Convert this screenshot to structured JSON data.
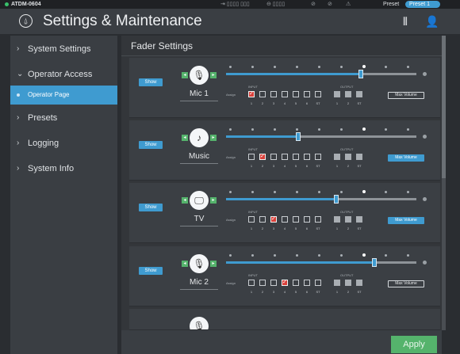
{
  "topbar": {
    "device": "ATDM-0604",
    "indicators": [
      "⇥ ▯▯▯▯ ▯▯▯",
      "⊖ ▯▯▯▯",
      "⊘",
      "⊘",
      "⚠"
    ],
    "preset_label": "Preset",
    "preset_value": "Preset 1"
  },
  "header": {
    "title": "Settings & Maintenance",
    "logo_icon": "audio-technica-logo",
    "right_icons": [
      "mixer-icon",
      "user-icon"
    ]
  },
  "sidebar": {
    "items": [
      {
        "label": "System Settings",
        "chevron": "›"
      },
      {
        "label": "Operator Access",
        "chevron": "⌄"
      },
      {
        "label": "Operator Page",
        "chevron": ""
      },
      {
        "label": "Presets",
        "chevron": "›"
      },
      {
        "label": "Logging",
        "chevron": "›"
      },
      {
        "label": "System Info",
        "chevron": "›"
      }
    ]
  },
  "main": {
    "title": "Fader Settings",
    "show_label": "Show",
    "input_label": "INPUT",
    "output_label": "OUTPUT",
    "assign_label": "Assign",
    "max_volume_label": "Max Volume",
    "input_numbers": [
      "1",
      "2",
      "3",
      "4",
      "5",
      "6",
      "ST"
    ],
    "output_numbers": [
      "1",
      "2",
      "ST"
    ],
    "channels": [
      {
        "name": "Mic 1",
        "icon": "🎙",
        "icon_name": "microphone-icon",
        "fader": 0.71,
        "assigned": 1,
        "max_style": "outline"
      },
      {
        "name": "Music",
        "icon": "♪",
        "icon_name": "music-note-icon",
        "fader": 0.38,
        "assigned": 2,
        "max_style": "filled"
      },
      {
        "name": "TV",
        "icon": "🖵",
        "icon_name": "monitor-icon",
        "fader": 0.58,
        "assigned": 3,
        "max_style": "filled"
      },
      {
        "name": "Mic 2",
        "icon": "🎙",
        "icon_name": "microphone-icon",
        "fader": 0.78,
        "assigned": 4,
        "max_style": "outline"
      }
    ]
  },
  "apply_label": "Apply",
  "colors": {
    "accent": "#3f9bd0",
    "green": "#55b36c",
    "checked": "#d9403a"
  }
}
